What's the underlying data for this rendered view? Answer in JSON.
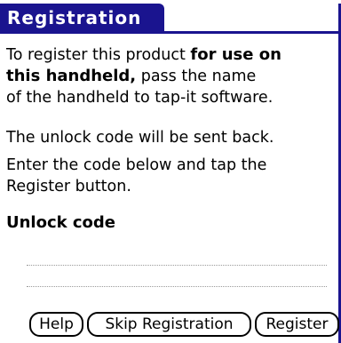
{
  "dialog": {
    "title": "Registration"
  },
  "instructions": {
    "line1_prefix": "To register this product ",
    "line1_bold": "for use on",
    "line2_bold": "this handheld,",
    "line2_rest": " pass the name",
    "line3": "of the handheld to tap-it software.",
    "line4": "The unlock code will be sent back.",
    "line5": "Enter the code below and tap the",
    "line6": "Register button."
  },
  "unlock": {
    "label": "Unlock code",
    "value_line1": "",
    "value_line2": ""
  },
  "buttons": {
    "help": "Help",
    "skip": "Skip Registration",
    "register": "Register"
  },
  "colors": {
    "title_background": "#1a148f",
    "title_text": "#ffffff"
  }
}
